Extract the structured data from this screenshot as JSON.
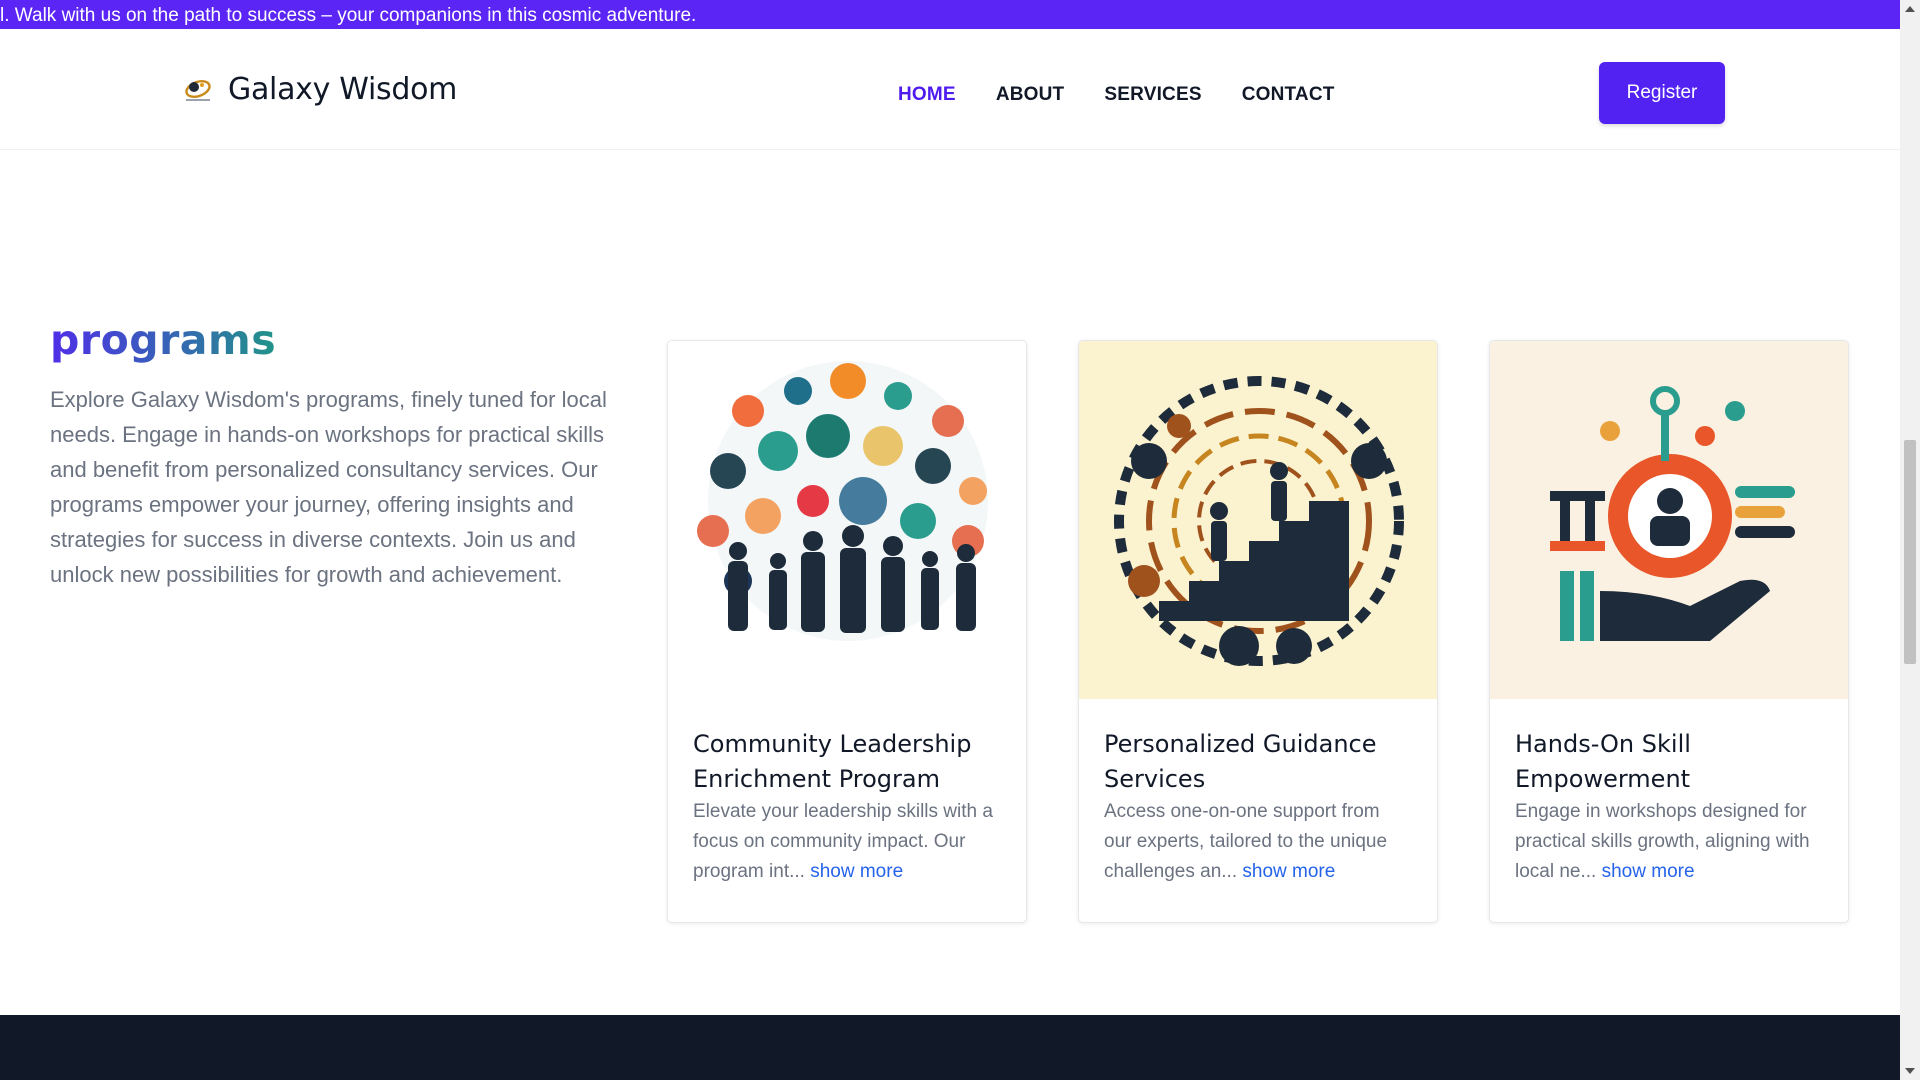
{
  "announcement": "l. Walk with us on the path to success – your companions in this cosmic adventure.",
  "nav": {
    "brand": "Galaxy Wisdom",
    "links": [
      "HOME",
      "ABOUT",
      "SERVICES",
      "CONTACT"
    ],
    "active": "HOME",
    "register": "Register"
  },
  "programs": {
    "title": "programs",
    "description": "Explore Galaxy Wisdom's programs, finely tuned for local needs. Engage in hands-on workshops for practical skills and benefit from personalized consultancy services. Our programs empower your journey, offering insights and strategies for success in diverse contexts. Join us and unlock new possibilities for growth and achievement.",
    "cards": [
      {
        "title": "Community Leadership Enrichment Program",
        "excerpt": "Elevate your leadership skills with a focus on community impact. Our program int...",
        "more": "show more"
      },
      {
        "title": "Personalized Guidance Services",
        "excerpt": "Access one-on-one support from our experts, tailored to the unique challenges an...",
        "more": "show more"
      },
      {
        "title": "Hands-On Skill Empowerment",
        "excerpt": "Engage in workshops designed for practical skills growth, aligning with local ne...",
        "more": "show more"
      }
    ]
  },
  "colors": {
    "accent": "#5b26f5",
    "footer": "#111827",
    "link": "#2563eb"
  }
}
